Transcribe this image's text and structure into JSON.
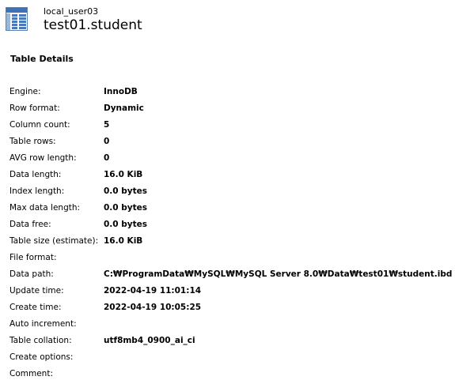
{
  "header": {
    "icon": "table-grid-icon",
    "connection": "local_user03",
    "table": "test01.student"
  },
  "section": {
    "title": "Table Details"
  },
  "details": [
    {
      "label": "Engine:",
      "value": "InnoDB"
    },
    {
      "label": "Row format:",
      "value": "Dynamic"
    },
    {
      "label": "Column count:",
      "value": "5"
    },
    {
      "label": "Table rows:",
      "value": "0"
    },
    {
      "label": "AVG row length:",
      "value": "0"
    },
    {
      "label": "Data length:",
      "value": "16.0 KiB"
    },
    {
      "label": "Index length:",
      "value": "0.0 bytes"
    },
    {
      "label": "Max data length:",
      "value": "0.0 bytes"
    },
    {
      "label": "Data free:",
      "value": "0.0 bytes"
    },
    {
      "label": "Table size (estimate):",
      "value": "16.0 KiB"
    },
    {
      "label": "File format:",
      "value": ""
    },
    {
      "label": "Data path:",
      "value": "C:₩ProgramData₩MySQL₩MySQL Server 8.0₩Data₩test01₩student.ibd"
    },
    {
      "label": "Update time:",
      "value": "2022-04-19 11:01:14"
    },
    {
      "label": "Create time:",
      "value": "2022-04-19 10:05:25"
    },
    {
      "label": "Auto increment:",
      "value": ""
    },
    {
      "label": "Table collation:",
      "value": "utf8mb4_0900_ai_ci"
    },
    {
      "label": "Create options:",
      "value": ""
    },
    {
      "label": "Comment:",
      "value": ""
    }
  ]
}
